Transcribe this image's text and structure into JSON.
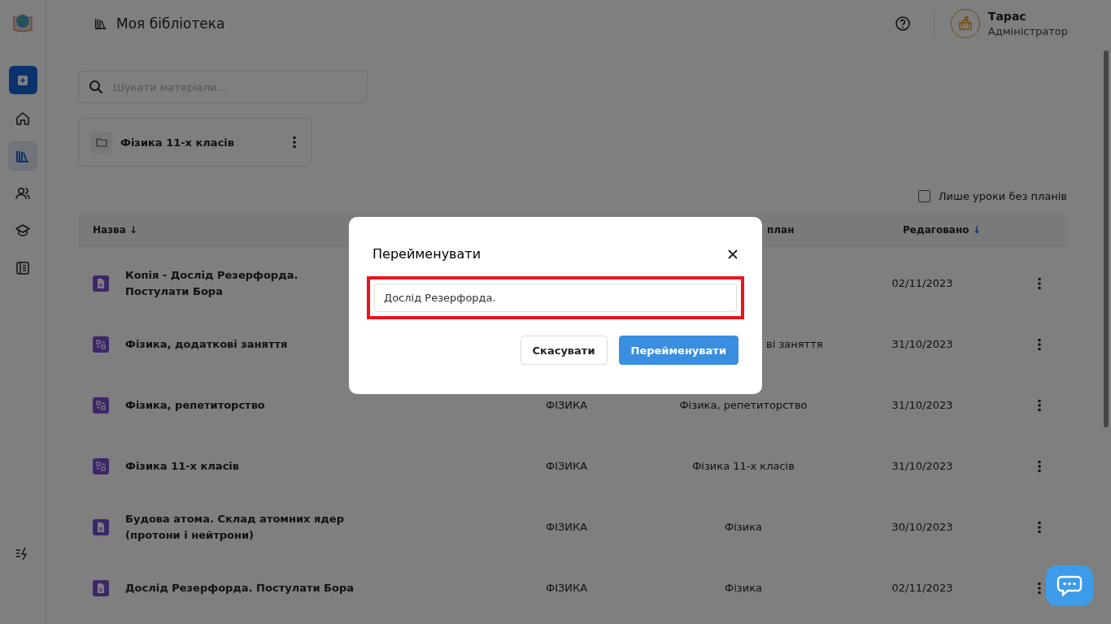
{
  "page_title": "Моя бібліотека",
  "user": {
    "name": "Тарас",
    "role": "Адміністратор"
  },
  "sidebar": {
    "items": [
      {
        "kind": "home",
        "selected": false
      },
      {
        "kind": "library",
        "selected": true
      },
      {
        "kind": "users",
        "selected": false
      },
      {
        "kind": "courses",
        "selected": false
      },
      {
        "kind": "journal",
        "selected": false
      }
    ]
  },
  "search": {
    "placeholder": "Шукати матеріали..."
  },
  "folders": [
    {
      "name": "Фізика 11-х класів"
    }
  ],
  "filter": {
    "label": "Лише уроки без планів",
    "checked": false
  },
  "table": {
    "columns": [
      {
        "label": "Назва",
        "arrow": "↓",
        "sorted": false
      },
      {
        "label": "план"
      },
      {
        "label": "Редаговано",
        "arrow": "↓",
        "sorted": true
      }
    ],
    "rows": [
      {
        "kind": "document",
        "name": "Копія - Дослід Резерфорда. Постулати Бора",
        "date": "02/11/2023"
      },
      {
        "kind": "group",
        "name": "Фізика, додаткові заняття",
        "plan": "ві заняття",
        "date": "31/10/2023"
      },
      {
        "kind": "group",
        "name": "Фізика, репетиторство",
        "subject": "ФІЗИКА",
        "plan": "Фізика, репетиторство",
        "date": "31/10/2023"
      },
      {
        "kind": "group",
        "name": "Фізика 11-х класів",
        "subject": "ФІЗИКА",
        "plan": "Фізика 11-х класів",
        "date": "31/10/2023"
      },
      {
        "kind": "document",
        "name": "Будова атома. Склад атомних ядер (протони і нейтрони)",
        "subject": "ФІЗИКА",
        "plan": "Фізика",
        "date": "30/10/2023"
      },
      {
        "kind": "document",
        "name": "Дослід Резерфорда. Постулати Бора",
        "subject": "ФІЗИКА",
        "plan": "Фізика",
        "date": "02/11/2023"
      }
    ]
  },
  "dialog": {
    "title": "Перейменувати",
    "value": "Дослід Резерфорда.",
    "highlighted": true,
    "buttons": [
      {
        "label": "Скасувати",
        "kind": "secondary"
      },
      {
        "label": "Перейменувати",
        "kind": "primary"
      }
    ]
  }
}
